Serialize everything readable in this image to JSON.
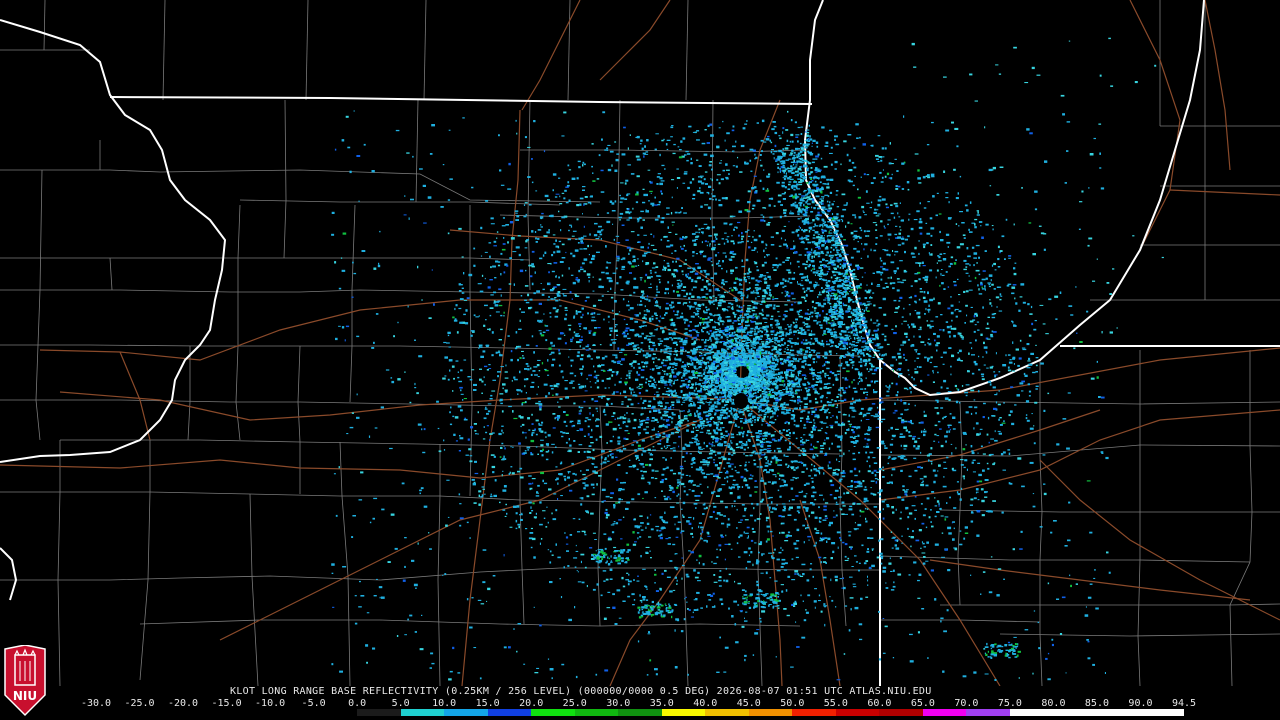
{
  "product": {
    "caption": "KLOT LONG RANGE BASE REFLECTIVITY (0.25KM / 256 LEVEL) (000000/0000 0.5 DEG) 2026-08-07 01:51 UTC  ATLAS.NIU.EDU"
  },
  "legend": {
    "ticks": [
      "-30.0",
      "-25.0",
      "-20.0",
      "-15.0",
      "-10.0",
      "-5.0",
      "0.0",
      "5.0",
      "10.0",
      "15.0",
      "20.0",
      "25.0",
      "30.0",
      "35.0",
      "40.0",
      "45.0",
      "50.0",
      "55.0",
      "60.0",
      "65.0",
      "70.0",
      "75.0",
      "80.0",
      "85.0",
      "90.0",
      "94.5"
    ],
    "colors": [
      "#000000",
      "#000000",
      "#000000",
      "#000000",
      "#000000",
      "#000000",
      "#1b1b1b",
      "#1fd0d0",
      "#13a6e8",
      "#1040e0",
      "#10e010",
      "#10b810",
      "#109010",
      "#f8f800",
      "#f0c000",
      "#f09000",
      "#f02000",
      "#c80000",
      "#b00000",
      "#f000f0",
      "#a040f0",
      "#ffffff",
      "#ffffff",
      "#ffffff",
      "#ffffff"
    ]
  },
  "logo": {
    "text": "NIU",
    "bg": "#c8102e"
  },
  "colors": {
    "background": "#000000",
    "county_lines": "#7a7a7a",
    "state_lines": "#ffffff",
    "roads": "#8a4a2a",
    "echo_main": "#1fb0e0",
    "echo_light": "#37d5e0",
    "echo_blue": "#1060e8",
    "echo_green": "#10c040"
  }
}
